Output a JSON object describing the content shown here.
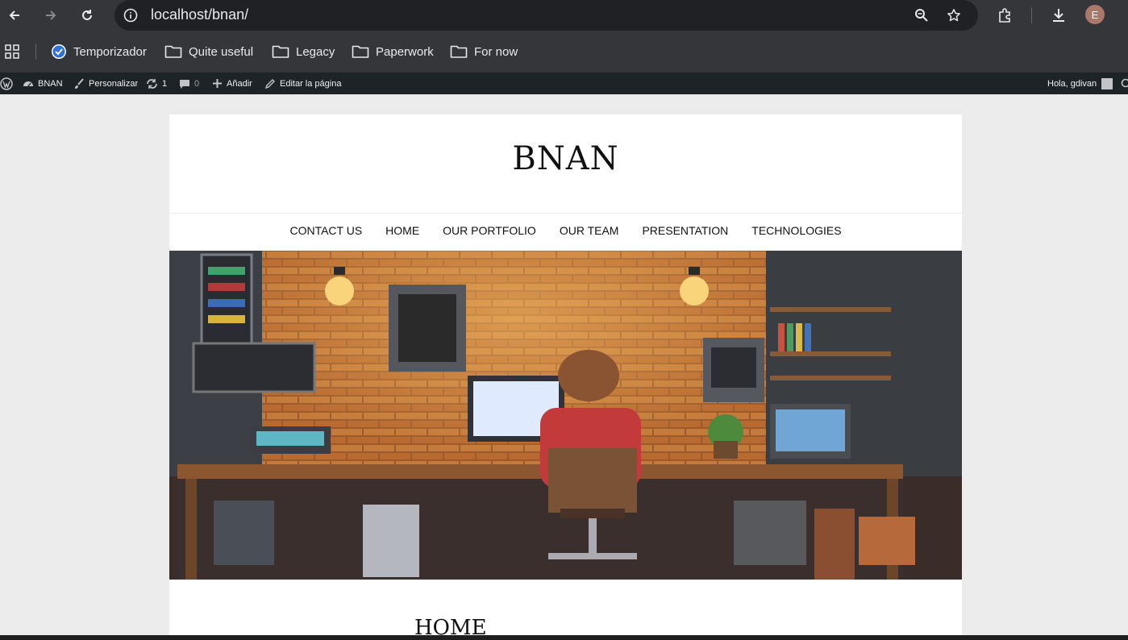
{
  "browser": {
    "url": "localhost/bnan",
    "url_display": "localhost/bnan/",
    "avatar_letter": "E",
    "bookmarks": [
      {
        "label": "Temporizador",
        "icon": "clock-check-icon"
      },
      {
        "label": "Quite useful",
        "icon": "folder-icon"
      },
      {
        "label": "Legacy",
        "icon": "folder-icon"
      },
      {
        "label": "Paperwork",
        "icon": "folder-icon"
      },
      {
        "label": "For now",
        "icon": "folder-icon"
      }
    ]
  },
  "wp_admin_bar": {
    "site": "BNAN",
    "customize": "Personalizar",
    "updates": "1",
    "comments": "0",
    "add_new": "Añadir",
    "edit_page": "Editar la página",
    "greeting": "Hola, gdivan"
  },
  "site": {
    "title": "BNAN",
    "menu": [
      "CONTACT US",
      "HOME",
      "OUR PORTFOLIO",
      "OUR TEAM",
      "PRESENTATION",
      "TECHNOLOGIES"
    ],
    "page_title": "HOME"
  },
  "colors": {
    "chrome_bg": "#35363a",
    "omnibox_bg": "#202124",
    "wp_bar_bg": "#1d2327",
    "page_bg": "#ececec"
  }
}
